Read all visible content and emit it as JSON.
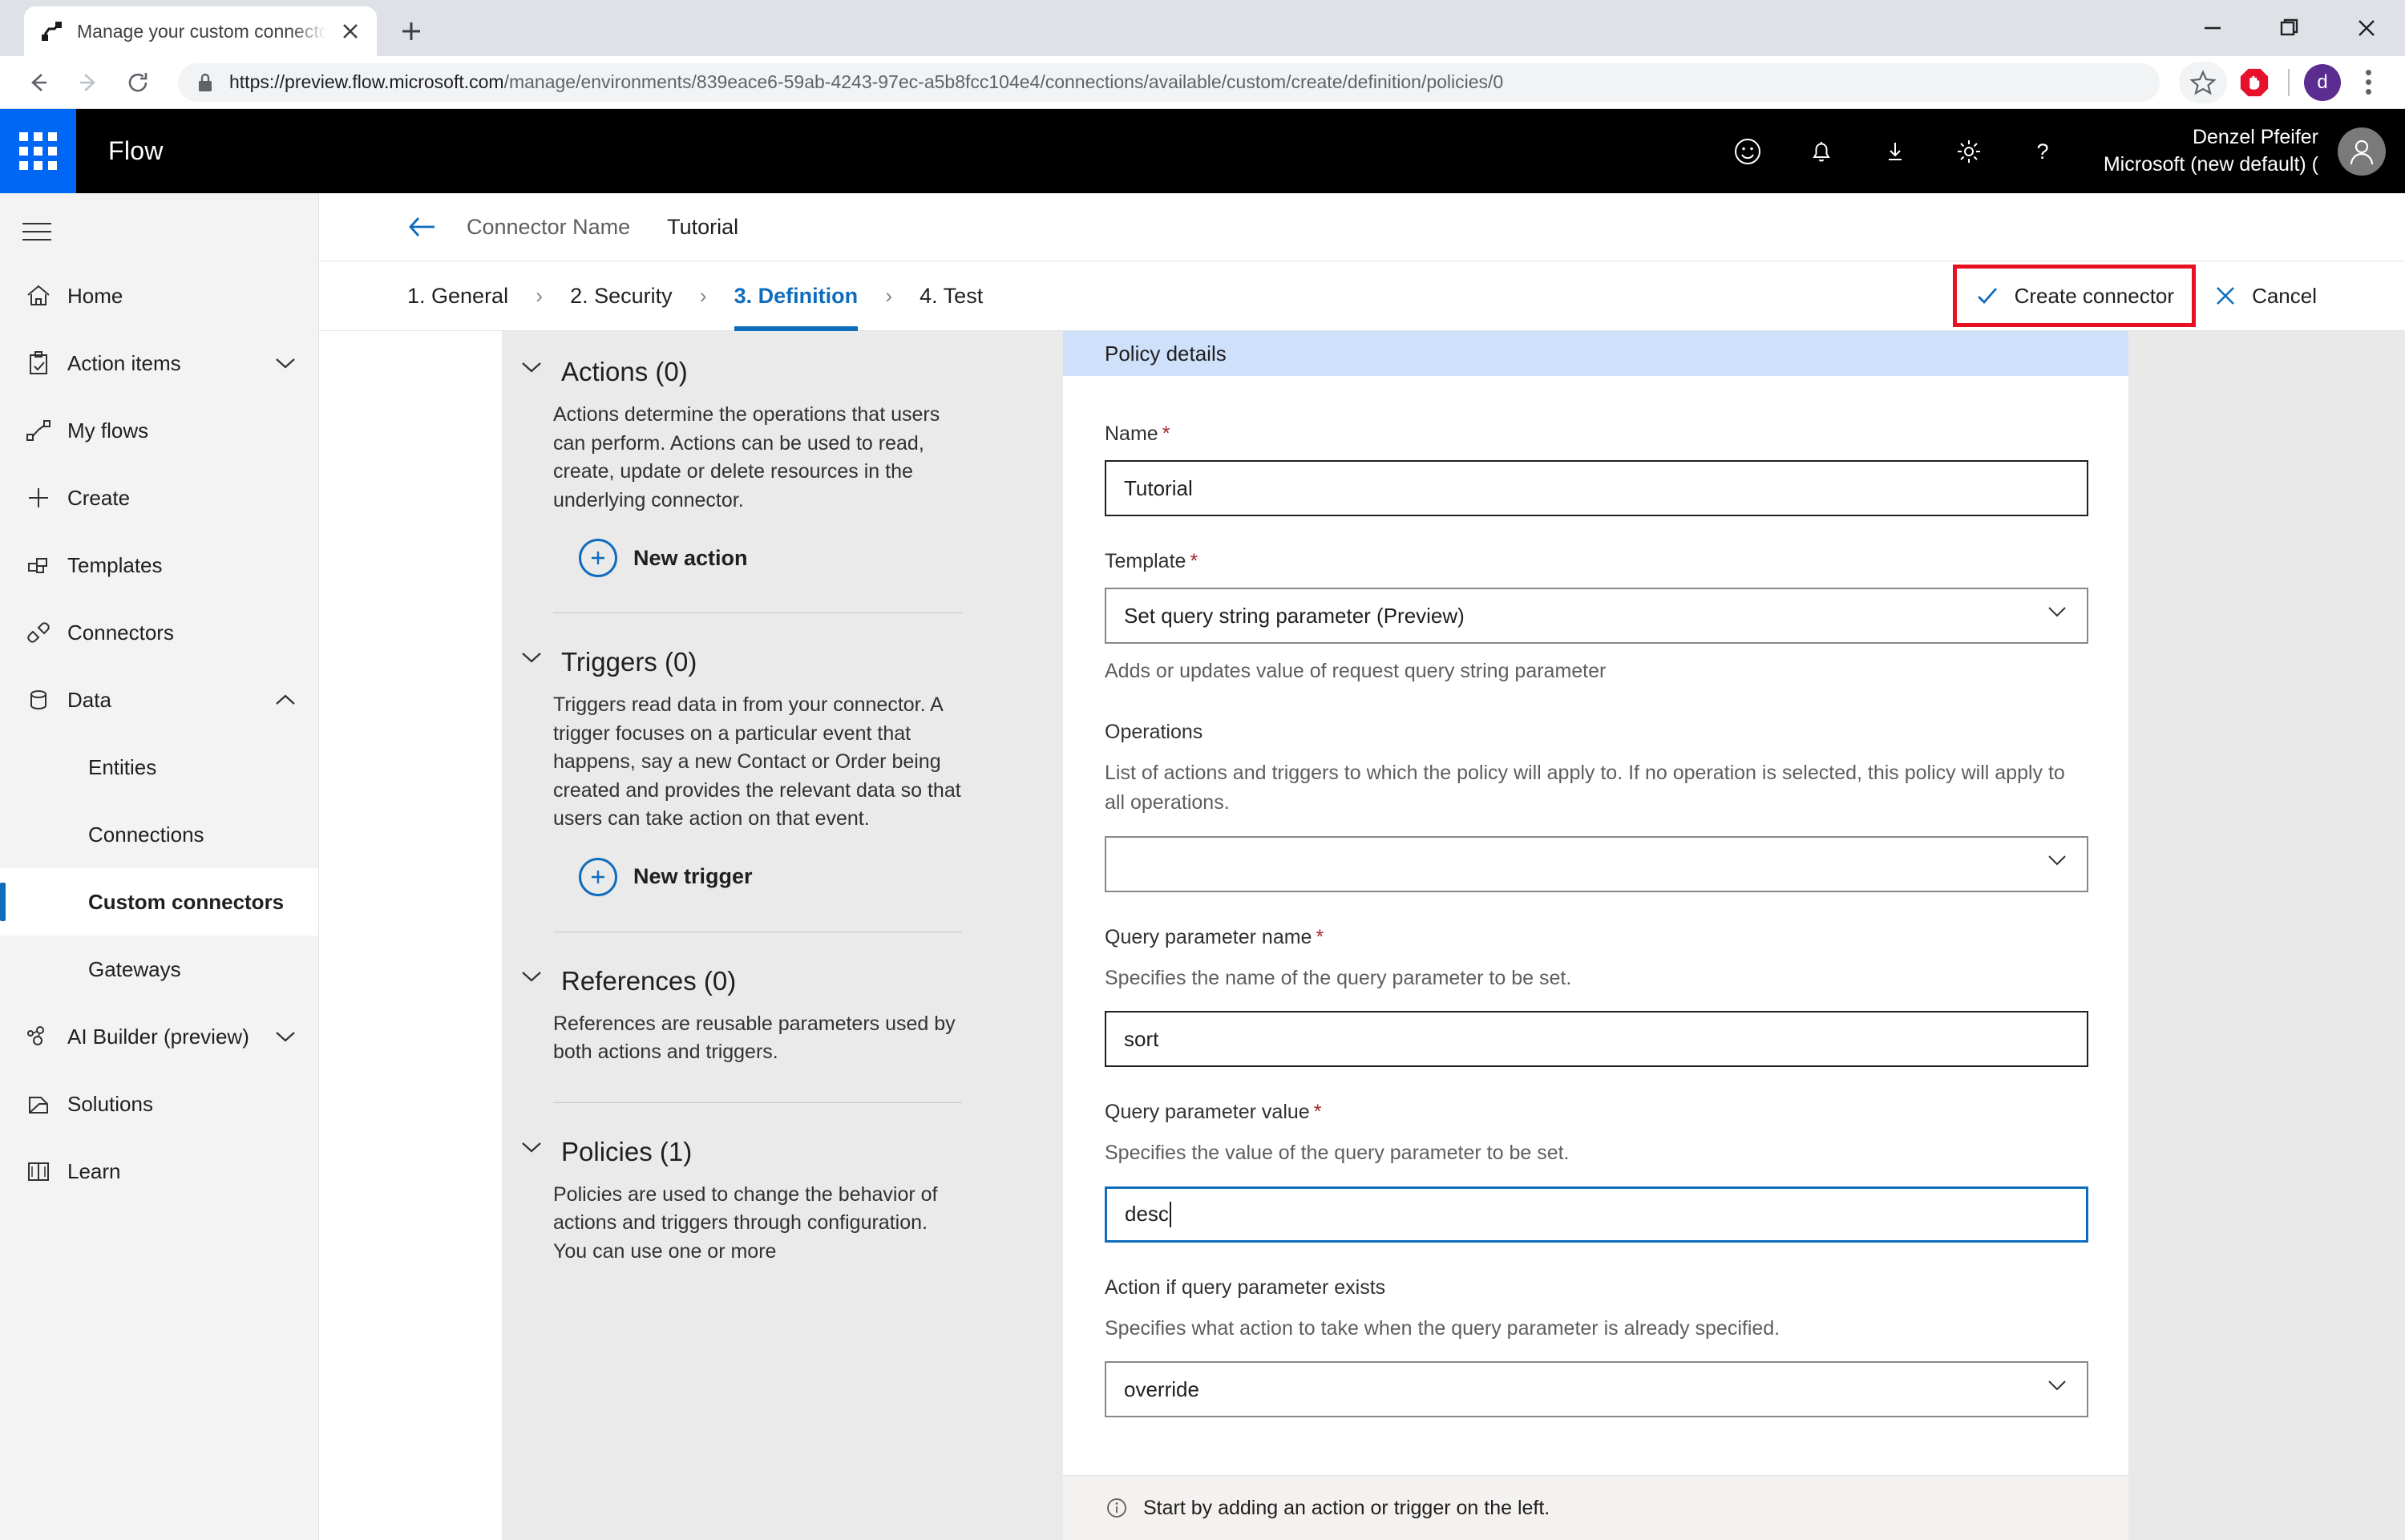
{
  "browser": {
    "tab": {
      "title": "Manage your custom connectors",
      "favicon_icon": "flow-logo-icon",
      "close_icon": "close-icon"
    },
    "new_tab_icon": "plus-icon",
    "window_controls": {
      "minimize_icon": "minimize-icon",
      "maximize_icon": "maximize-icon",
      "close_icon": "window-close-icon"
    },
    "nav": {
      "back_icon": "back-arrow-icon",
      "forward_icon": "forward-arrow-icon",
      "reload_icon": "reload-icon"
    },
    "omnibox": {
      "lock_icon": "lock-icon",
      "url_domain": "https://preview.flow.microsoft.com",
      "url_path": "/manage/environments/839eace6-59ab-4243-97ec-a5b8fcc104e4/connections/available/custom/create/definition/policies/0"
    },
    "toolbar_icons": {
      "bookmark_star": "star-icon",
      "adblock": "adblock-stop-hand-icon",
      "profile_letter": "d",
      "menu": "three-dot-menu-icon"
    }
  },
  "flow_bar": {
    "waffle_icon": "app-launcher-waffle-icon",
    "logo": "Flow",
    "icons": [
      {
        "name": "smiley-feedback-icon"
      },
      {
        "name": "bell-notifications-icon"
      },
      {
        "name": "download-icon"
      },
      {
        "name": "gear-settings-icon"
      },
      {
        "name": "question-help-icon"
      }
    ],
    "user_name": "Denzel Pfeifer",
    "user_tenant": "Microsoft (new default) (",
    "avatar_icon": "user-avatar-icon"
  },
  "sidebar": {
    "hamburger_icon": "hamburger-menu-icon",
    "items": [
      {
        "label": "Home",
        "icon": "home-icon",
        "chevron": "",
        "level": "top",
        "active": false
      },
      {
        "label": "Action items",
        "icon": "clipboard-check-icon",
        "chevron": "down",
        "level": "top",
        "active": false
      },
      {
        "label": "My flows",
        "icon": "flow-path-icon",
        "chevron": "",
        "level": "top",
        "active": false
      },
      {
        "label": "Create",
        "icon": "plus-icon",
        "chevron": "",
        "level": "top",
        "active": false
      },
      {
        "label": "Templates",
        "icon": "templates-icon",
        "chevron": "",
        "level": "top",
        "active": false
      },
      {
        "label": "Connectors",
        "icon": "connector-plug-icon",
        "chevron": "",
        "level": "top",
        "active": false
      },
      {
        "label": "Data",
        "icon": "database-icon",
        "chevron": "up",
        "level": "top",
        "active": false
      },
      {
        "label": "Entities",
        "icon": "",
        "chevron": "",
        "level": "sub",
        "active": false
      },
      {
        "label": "Connections",
        "icon": "",
        "chevron": "",
        "level": "sub",
        "active": false
      },
      {
        "label": "Custom connectors",
        "icon": "",
        "chevron": "",
        "level": "sub",
        "active": true
      },
      {
        "label": "Gateways",
        "icon": "",
        "chevron": "",
        "level": "sub",
        "active": false
      },
      {
        "label": "AI Builder (preview)",
        "icon": "ai-builder-icon",
        "chevron": "down",
        "level": "top",
        "active": false
      },
      {
        "label": "Solutions",
        "icon": "solutions-icon",
        "chevron": "",
        "level": "top",
        "active": false
      },
      {
        "label": "Learn",
        "icon": "book-learn-icon",
        "chevron": "",
        "level": "top",
        "active": false
      }
    ]
  },
  "breadcrumb": {
    "back_icon": "back-arrow-icon",
    "label": "Connector Name",
    "value": "Tutorial"
  },
  "wizard": {
    "steps": [
      {
        "label": "1. General",
        "active": false
      },
      {
        "label": "2. Security",
        "active": false
      },
      {
        "label": "3. Definition",
        "active": true
      },
      {
        "label": "4. Test",
        "active": false
      }
    ],
    "separator": "›",
    "create_button": {
      "label": "Create connector",
      "icon": "checkmark-icon",
      "highlighted": true
    },
    "cancel_button": {
      "label": "Cancel",
      "icon": "close-x-icon"
    },
    "highlight_color": "#e81123"
  },
  "definition_panel": {
    "sections": [
      {
        "title": "Actions (0)",
        "description": "Actions determine the operations that users can perform. Actions can be used to read, create, update or delete resources in the underlying connector.",
        "add_label": "New action",
        "chevron_icon": "chevron-down-icon",
        "plus_icon": "plus-circle-icon"
      },
      {
        "title": "Triggers (0)",
        "description": "Triggers read data in from your connector. A trigger focuses on a particular event that happens, say a new Contact or Order being created and provides the relevant data so that users can take action on that event.",
        "add_label": "New trigger",
        "chevron_icon": "chevron-down-icon",
        "plus_icon": "plus-circle-icon"
      },
      {
        "title": "References (0)",
        "description": "References are reusable parameters used by both actions and triggers.",
        "add_label": "",
        "chevron_icon": "chevron-down-icon",
        "plus_icon": ""
      },
      {
        "title": "Policies (1)",
        "description": "Policies are used to change the behavior of actions and triggers through configuration. You can use one or more",
        "add_label": "",
        "chevron_icon": "chevron-down-icon",
        "plus_icon": ""
      }
    ]
  },
  "policy_form": {
    "header": "Policy details",
    "fields": [
      {
        "label": "Name",
        "required": true,
        "help": "",
        "type": "text",
        "value": "Tutorial",
        "focused": false
      },
      {
        "label": "Template",
        "required": true,
        "help": "",
        "type": "select",
        "value": "Set query string parameter (Preview)",
        "caption": "Adds or updates value of request query string parameter"
      },
      {
        "label": "Operations",
        "required": false,
        "help": "List of actions and triggers to which the policy will apply to. If no operation is selected, this policy will apply to all operations.",
        "type": "select",
        "value": ""
      },
      {
        "label": "Query parameter name",
        "required": true,
        "help": "Specifies the name of the query parameter to be set.",
        "type": "text",
        "value": "sort",
        "focused": false
      },
      {
        "label": "Query parameter value",
        "required": true,
        "help": "Specifies the value of the query parameter to be set.",
        "type": "text",
        "value": "desc",
        "focused": true
      },
      {
        "label": "Action if query parameter exists",
        "required": false,
        "help": "Specifies what action to take when the query parameter is already specified.",
        "type": "select",
        "value": "override"
      }
    ]
  },
  "statusbar": {
    "info_icon": "info-circle-icon",
    "message": "Start by adding an action or trigger on the left."
  }
}
